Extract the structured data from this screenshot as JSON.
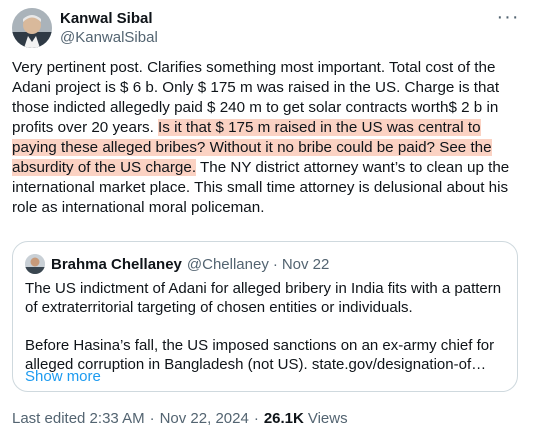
{
  "tweet": {
    "author_name": "Kanwal Sibal",
    "author_handle": "@KanwalSibal",
    "more_icon": "···",
    "text_before": "Very pertinent post. Clarifies something most important. Total  cost of the Adani project is $ 6 b. Only $ 175 m was raised in the US. Charge is that those indicted allegedly  paid $ 240 m to get solar contracts worth$ 2 b in profits over 20 years. ",
    "text_highlighted": "Is it that $ 175 m  raised in the US was central to paying these alleged bribes? Without it no bribe could be paid? See the absurdity of the US charge.",
    "text_after": " The NY district attorney want’s to clean up the international market place. This small time attorney is delusional about his role as international moral policeman."
  },
  "quote": {
    "author_name": "Brahma Chellaney",
    "author_handle": "@Chellaney",
    "separator": "·",
    "date": "Nov 22",
    "paragraph1": "The US indictment of Adani for alleged bribery in India fits with a pattern of extraterritorial targeting of chosen entities or individuals.",
    "paragraph2": "Before Hasina’s fall, the US imposed sanctions on an ex-army chief for alleged corruption in Bangladesh (not US). state.gov/designation-of…",
    "show_more": "Show more"
  },
  "meta": {
    "edited_time": "Last edited 2:33 AM",
    "separator": "·",
    "date": "Nov 22, 2024",
    "views_count": "26.1K",
    "views_label": "Views"
  },
  "colors": {
    "highlight": "#fbd2c3",
    "link": "#1d9bf0",
    "secondary_text": "#536471"
  }
}
